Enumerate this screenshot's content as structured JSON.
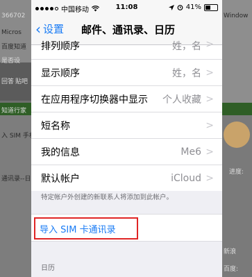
{
  "background": {
    "left_texts": [
      "366702",
      "Micros",
      "百度知道",
      "是否设",
      "回答",
      "贴吧",
      "知道行家",
      "入 SIM 手机",
      "通讯录--日历"
    ],
    "right_texts": [
      "Window",
      "进度:",
      "新浪",
      "百度:"
    ]
  },
  "statusbar": {
    "carrier": "中国移动",
    "time": "11:08",
    "battery": "41%",
    "battery_level": 0.41
  },
  "navbar": {
    "back_label": "设置",
    "title": "邮件、通讯录、日历"
  },
  "rows": [
    {
      "label": "排列顺序",
      "value": "姓，名"
    },
    {
      "label": "显示顺序",
      "value": "姓，名"
    },
    {
      "label": "在应用程序切换器中显示",
      "value": "个人收藏"
    },
    {
      "label": "短名称",
      "value": ""
    },
    {
      "label": "我的信息",
      "value": "Me6"
    },
    {
      "label": "默认帐户",
      "value": "iCloud"
    }
  ],
  "footer_note": "特定帐户外创建的新联系人将添加到此帐户。",
  "import_sim": "导入 SIM 卡通讯录",
  "calendar_section": "日历",
  "colors": {
    "accent": "#1a7cf5",
    "highlight_border": "#e02424"
  }
}
